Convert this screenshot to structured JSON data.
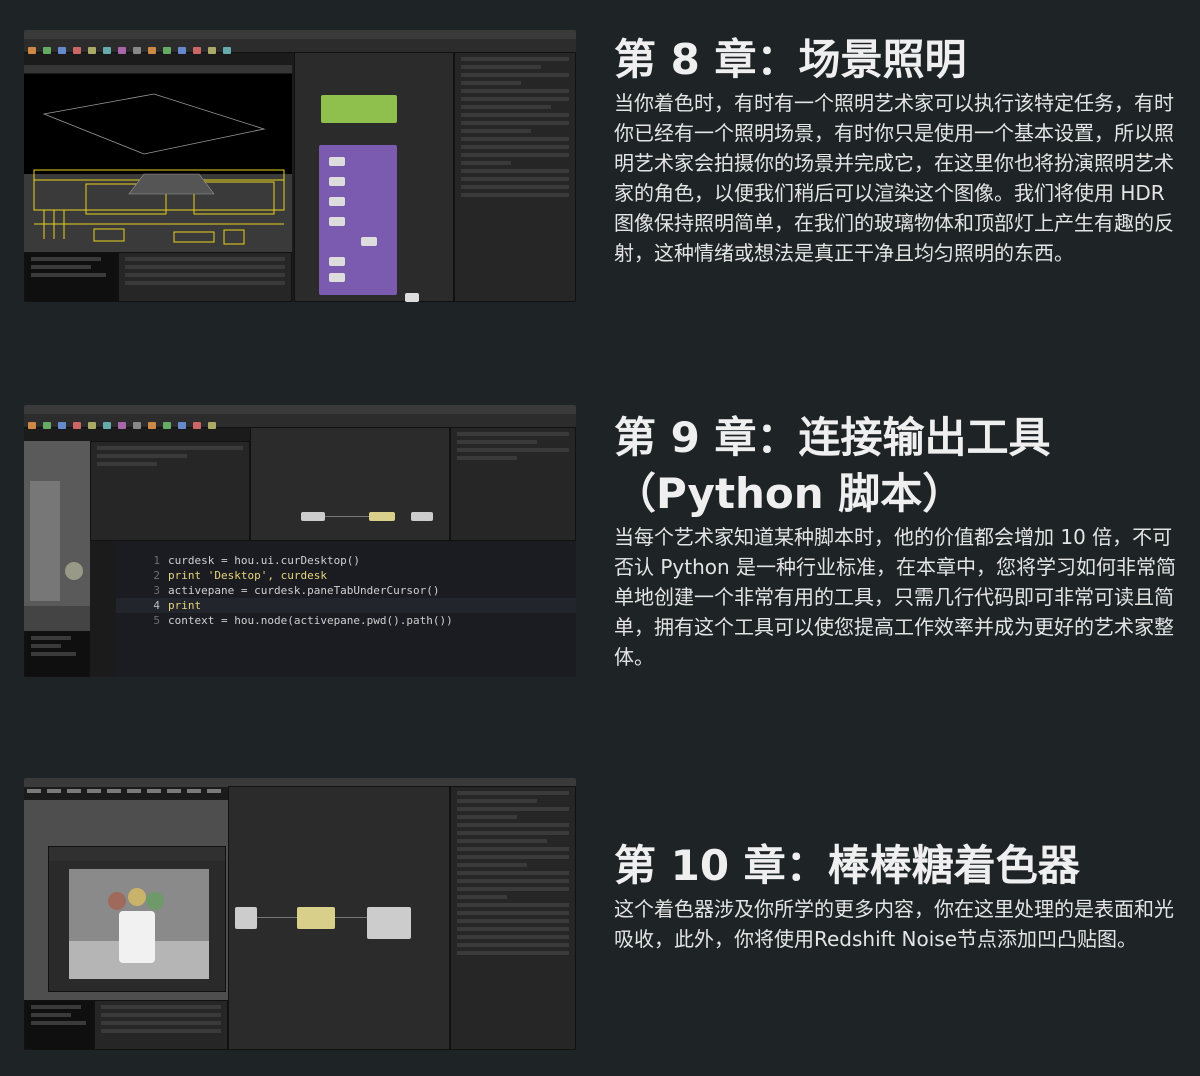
{
  "chapters": [
    {
      "title": "第 8 章：场景照明",
      "body": "当你着色时，有时有一个照明艺术家可以执行该特定任务，有时你已经有一个照明场景，有时你只是使用一个基本设置，所以照明艺术家会拍摄你的场景并完成它，在这里你也将扮演照明艺术家的角色，以便我们稍后可以渲染这个图像。我们将使用 HDR 图像保持照明简单，在我们的玻璃物体和顶部灯上产生有趣的反射，这种情绪或想法是真正干净且均匀照明的东西。"
    },
    {
      "title_line1": "第 9 章：连接输出工具",
      "title_line2": "（Python 脚本）",
      "body": "当每个艺术家知道某种脚本时，他的价值都会增加 10 倍，不可否认 Python 是一种行业标准，在本章中，您将学习如何非常简单地创建一个非常有用的工具，只需几行代码即可非常可读且简单，拥有这个工具可以使您提高工作效率并成为更好的艺术家整体。"
    },
    {
      "title": "第 10 章：棒棒糖着色器",
      "body": "这个着色器涉及你所学的更多内容，你在这里处理的是表面和光吸收，此外，你将使用Redshift Noise节点添加凹凸贴图。"
    }
  ],
  "code_editor": {
    "lines": [
      {
        "num": "1",
        "text": "curdesk = hou.ui.curDesktop()"
      },
      {
        "num": "2",
        "text": "print 'Desktop', curdesk"
      },
      {
        "num": "3",
        "text": "activepane = curdesk.paneTabUnderCursor()"
      },
      {
        "num": "4",
        "text": "print"
      },
      {
        "num": "5",
        "text": "context = hou.node(activepane.pwd().path())"
      }
    ]
  },
  "colors": {
    "background": "#1e2426",
    "node_green": "#8fbf4d",
    "node_purple": "#7a5bb0",
    "wireframe_yellow": "#e8d21c"
  }
}
